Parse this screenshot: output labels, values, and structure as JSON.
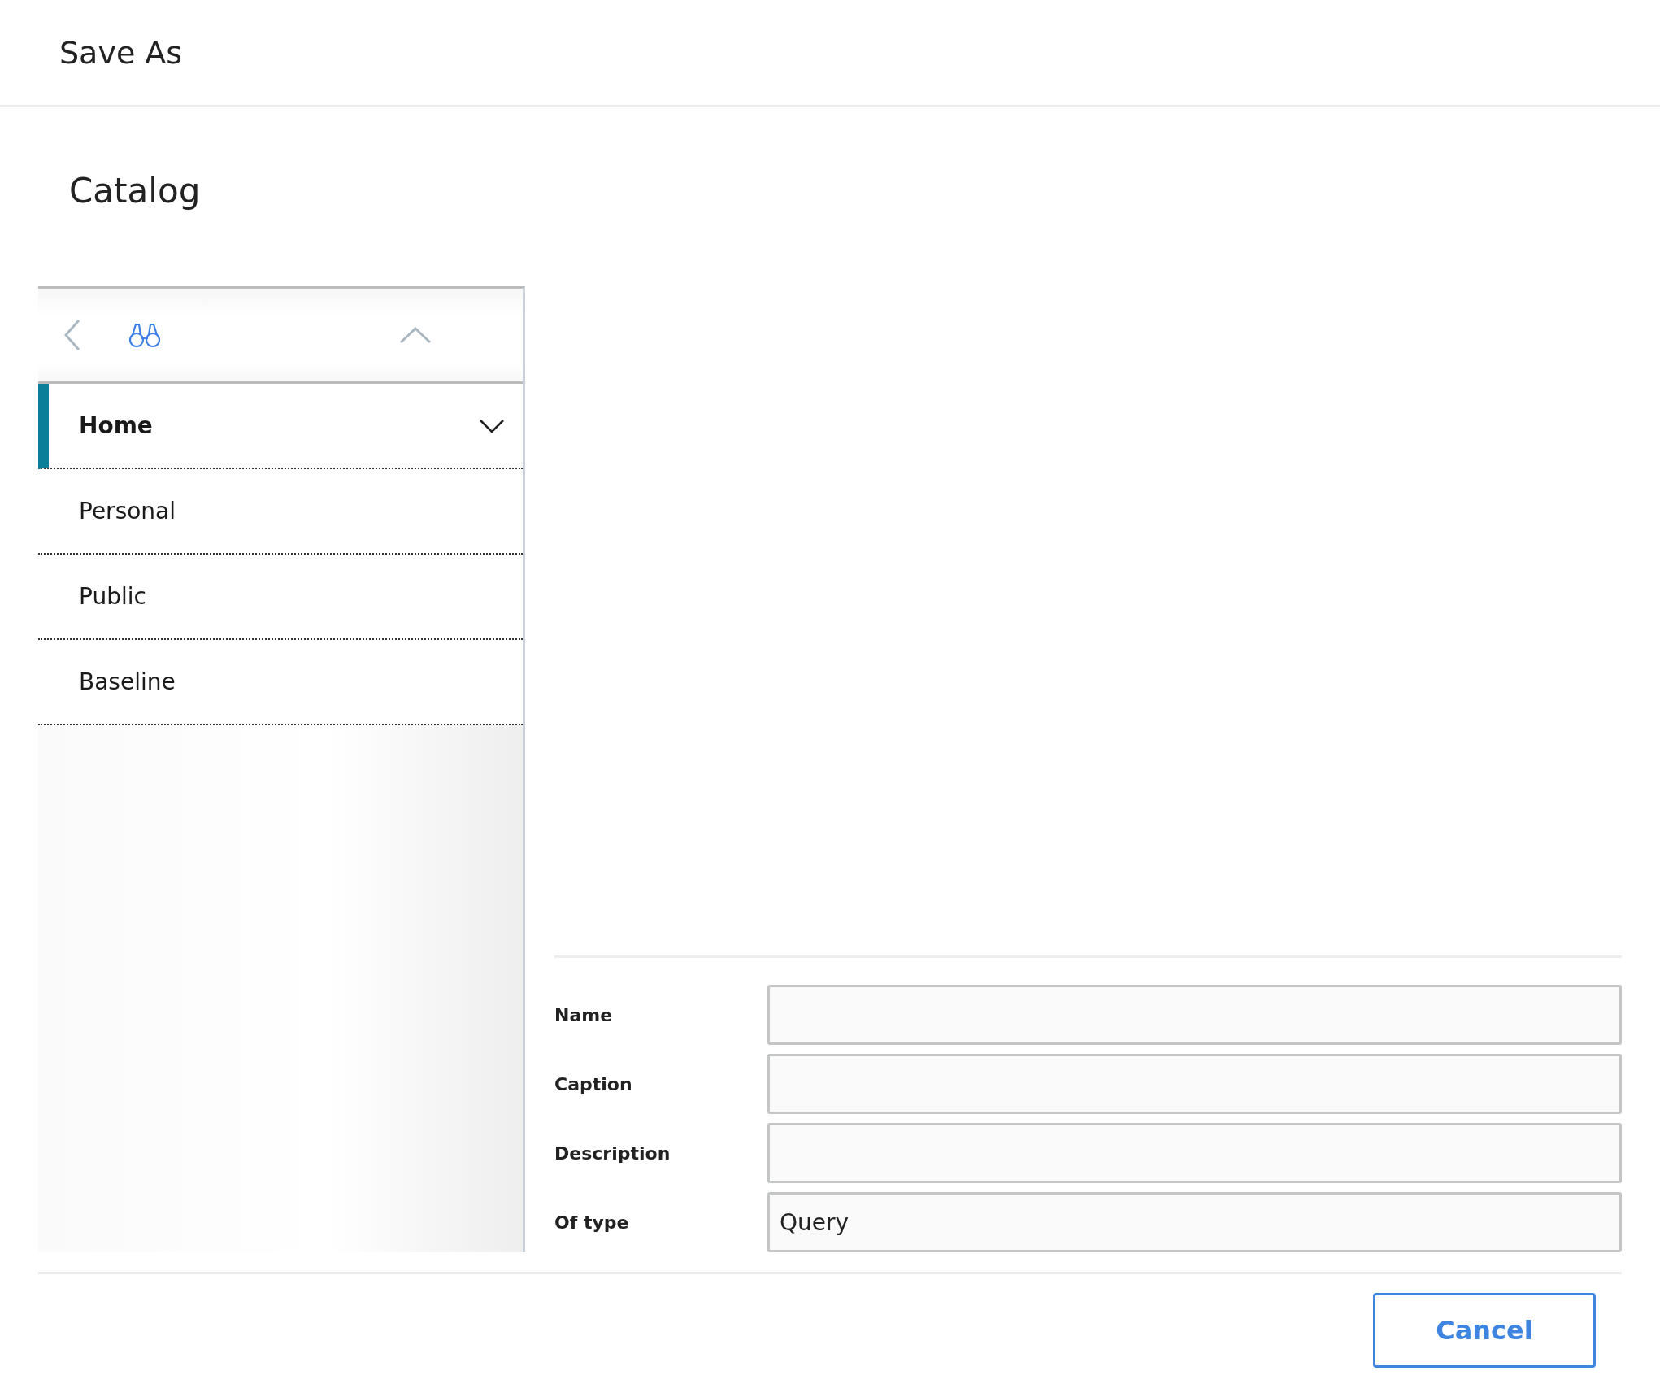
{
  "window": {
    "title": "Save As"
  },
  "catalog": {
    "title": "Catalog",
    "items": [
      {
        "label": "Home",
        "selected": true,
        "expanded": true
      },
      {
        "label": "Personal",
        "selected": false
      },
      {
        "label": "Public",
        "selected": false
      },
      {
        "label": "Baseline",
        "selected": false
      }
    ]
  },
  "form": {
    "fields": [
      {
        "label": "Name"
      },
      {
        "label": "Caption"
      },
      {
        "label": "Description"
      },
      {
        "label": "Of type",
        "value": "Query"
      }
    ]
  },
  "buttons": [
    {
      "label": "Cancel"
    }
  ]
}
